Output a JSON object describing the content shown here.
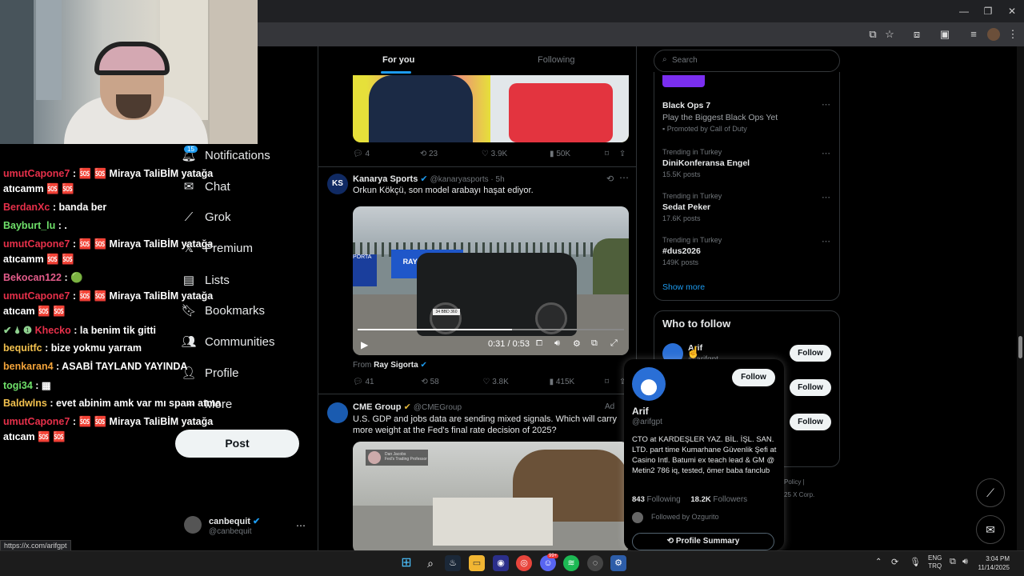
{
  "browser": {
    "statusbar_url": "https://x.com/arifgpt"
  },
  "chat": {
    "lines": [
      {
        "user": "umutCapone7",
        "text": " : 🆘 🆘 Miraya TaliBİM yatağa",
        "cont": "atıcamm 🆘 🆘",
        "color": "#e6304a"
      },
      {
        "user": "BerdanXc",
        "text": " : banda ber",
        "color": "#e6304a"
      },
      {
        "user": "Bayburt_lu",
        "text": " : .",
        "color": "#6fe06a"
      },
      {
        "user": "umutCapone7",
        "text": " : 🆘 🆘 Miraya TaliBİM yatağa",
        "cont": "atıcamm 🆘 🆘",
        "color": "#e6304a"
      },
      {
        "user": "Bekocan122",
        "text": " : 🟢",
        "color": "#e35c8a"
      },
      {
        "user": "umutCapone7",
        "text": " : 🆘 🆘 Miraya TaliBİM yatağa",
        "cont": "atıcam 🆘 🆘",
        "color": "#e6304a"
      },
      {
        "user": "Khecko",
        "text": " : la benim tik gitti",
        "prefix": "✔ 🌢 ❶ ",
        "color": "#e6304a"
      },
      {
        "user": "bequitfc",
        "text": " : bize yokmu yarram",
        "color": "#f2c14e"
      },
      {
        "user": "benkaran4",
        "text": " : ASABİ TAYLAND YAYINDA",
        "color": "#f2a33a"
      },
      {
        "user": "togi34",
        "text": " : ▦",
        "color": "#6fe06a"
      },
      {
        "user": "Baldwlns",
        "text": " : evet abinim amk var mı spam atma",
        "color": "#f2c14e"
      },
      {
        "user": "umutCapone7",
        "text": " : 🆘 🆘 Miraya TaliBİM yatağa",
        "cont": "atıcam 🆘 🆘",
        "color": "#e6304a"
      }
    ]
  },
  "nav": {
    "notifications": "Notifications",
    "notif_badge": "15",
    "chat": "Chat",
    "grok": "Grok",
    "premium": "Premium",
    "lists": "Lists",
    "bookmarks": "Bookmarks",
    "communities": "Communities",
    "profile": "Profile",
    "more": "More",
    "post": "Post",
    "account_name": "canbequit",
    "account_handle": "@canbequit"
  },
  "feed": {
    "tab_for_you": "For you",
    "tab_following": "Following",
    "post1_stats": {
      "replies": "4",
      "reposts": "23",
      "likes": "3.9K",
      "views": "50K"
    },
    "post2": {
      "name": "Kanarya Sports",
      "handle": "@kanaryasports · 5h",
      "text": "Orkun Kökçü, son model arabayı haşat ediyor.",
      "video_time": "0:31 / 0:53",
      "sign_text": "RAY SİGORTA",
      "plate": "34 BBD 360",
      "from_label": "From",
      "from_name": "Ray Sigorta",
      "replies": "41",
      "reposts": "58",
      "likes": "3.8K",
      "views": "415K"
    },
    "post3": {
      "name": "CME Group",
      "handle": "@CMEGroup",
      "ad": "Ad",
      "text": "U.S. GDP and jobs data are sending mixed signals. Which will carry more weight at the Fed's final rate decision of 2025?",
      "overlay": "Dan Jacobs\nFed's Trading Professor"
    }
  },
  "right": {
    "search_placeholder": "Search",
    "ad_title": "Black Ops 7",
    "ad_sub": "Play the Biggest Black Ops Yet",
    "ad_promo": "Promoted by Call of Duty",
    "trends": [
      {
        "meta": "Trending in Turkey",
        "name": "DiniKonferansa Engel",
        "count": "15.5K posts"
      },
      {
        "meta": "Trending in Turkey",
        "name": "Sedat Peker",
        "count": "17.6K posts"
      },
      {
        "meta": "Trending in Turkey",
        "name": "#dus2026",
        "count": "149K posts"
      }
    ],
    "show_more": "Show more",
    "who_title": "Who to follow",
    "who1_name": "Arif",
    "who1_handle": "@arifgpt",
    "follow": "Follow",
    "footer1": "Policy  |",
    "footer2": "25 X Corp."
  },
  "hovercard": {
    "name": "Arif",
    "handle": "@arifgpt",
    "follow": "Follow",
    "bio": "CTO at KARDEŞLER YAZ. BİL. İŞL. SAN. LTD. part time Kumarhane Güvenlik Şefi at Casino Intl. Batumi ex teach lead & GM @ Metin2 786 iq, tested, ömer baba fanclub",
    "following_count": "843",
    "following_label": "Following",
    "followers_count": "18.2K",
    "followers_label": "Followers",
    "followed_by": "Followed by Ozgurito",
    "summary": "Profile Summary"
  },
  "taskbar": {
    "lang": "ENG",
    "region": "TRQ",
    "time": "3:04 PM",
    "date": "11/14/2025",
    "discord_badge": "99+"
  },
  "colors": {
    "accent": "#1d9bf0",
    "chrome": "#202124"
  }
}
